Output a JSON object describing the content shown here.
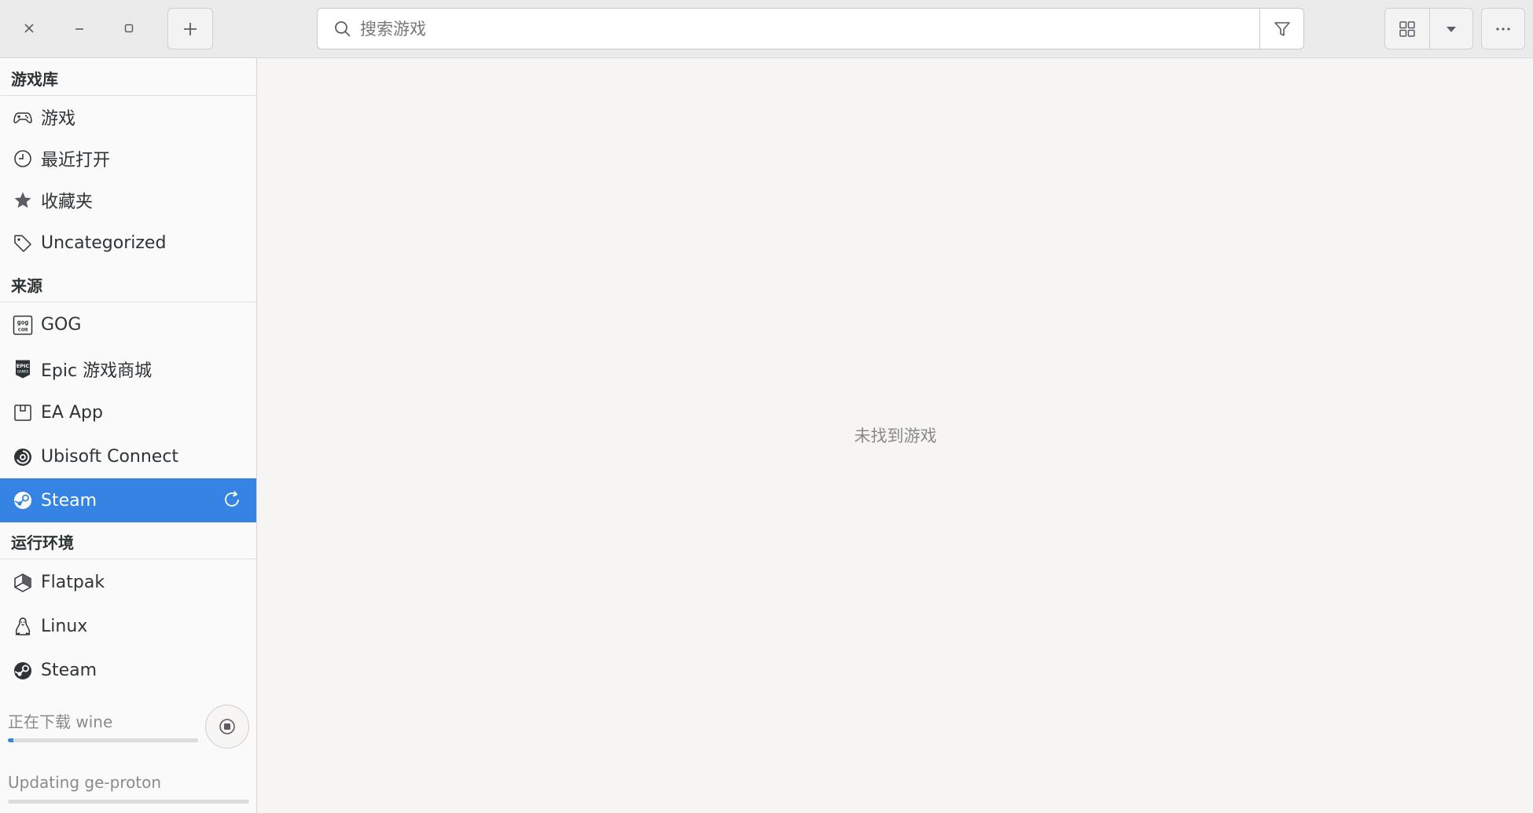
{
  "header": {
    "search_placeholder": "搜索游戏"
  },
  "sidebar": {
    "library_title": "游戏库",
    "library_items": [
      {
        "label": "游戏",
        "icon": "gamepad-icon"
      },
      {
        "label": "最近打开",
        "icon": "clock-icon"
      },
      {
        "label": "收藏夹",
        "icon": "star-icon"
      },
      {
        "label": "Uncategorized",
        "icon": "tag-icon"
      }
    ],
    "sources_title": "来源",
    "source_items": [
      {
        "label": "GOG",
        "icon": "gog-icon"
      },
      {
        "label": "Epic 游戏商城",
        "icon": "epic-icon"
      },
      {
        "label": "EA App",
        "icon": "ea-icon"
      },
      {
        "label": "Ubisoft Connect",
        "icon": "ubisoft-icon"
      },
      {
        "label": "Steam",
        "icon": "steam-icon",
        "active": true
      }
    ],
    "runners_title": "运行环境",
    "runner_items": [
      {
        "label": "Flatpak",
        "icon": "flatpak-icon"
      },
      {
        "label": "Linux",
        "icon": "linux-icon"
      },
      {
        "label": "Steam",
        "icon": "steam-icon"
      }
    ],
    "downloads": [
      {
        "label": "正在下载 wine",
        "progress": 0.03
      },
      {
        "label": "Updating ge-proton",
        "progress": 0.0
      }
    ]
  },
  "main": {
    "empty_text": "未找到游戏"
  },
  "colors": {
    "accent": "#3584e4",
    "header_bg": "#ebebeb",
    "sidebar_bg": "#fafafa"
  }
}
